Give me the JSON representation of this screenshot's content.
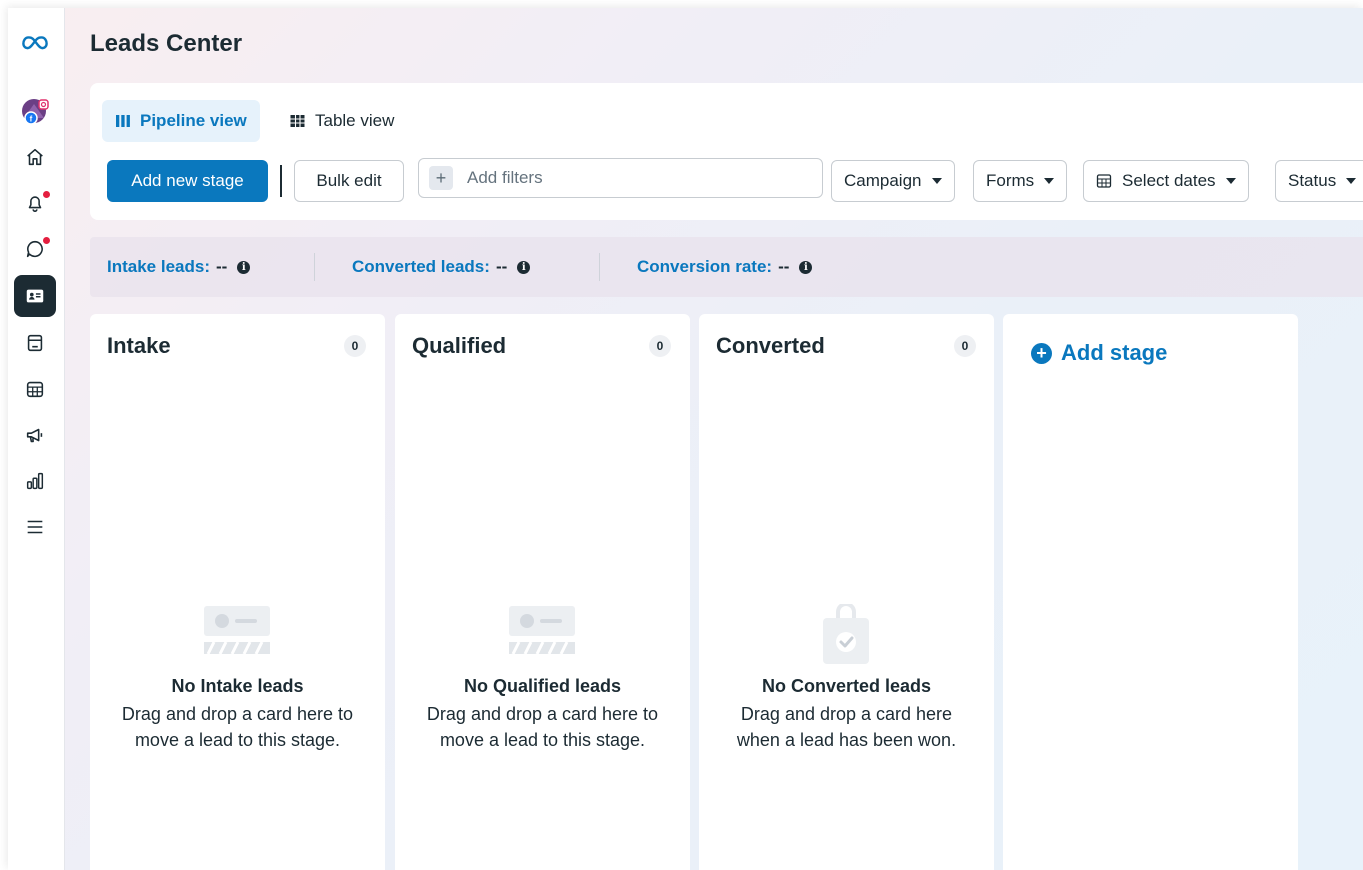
{
  "app": {
    "title": "Leads Center"
  },
  "nav": {
    "items": [
      {
        "name": "meta-logo-icon"
      },
      {
        "name": "account-avatar"
      },
      {
        "name": "home-icon"
      },
      {
        "name": "notifications-icon"
      },
      {
        "name": "messages-icon"
      },
      {
        "name": "leads-center-icon"
      },
      {
        "name": "posts-icon"
      },
      {
        "name": "calendar-icon"
      },
      {
        "name": "ads-icon"
      },
      {
        "name": "insights-icon"
      },
      {
        "name": "menu-icon"
      }
    ]
  },
  "views": {
    "pipeline": "Pipeline view",
    "table": "Table view"
  },
  "toolbar": {
    "add_stage": "Add new stage",
    "bulk_edit": "Bulk edit",
    "filter_placeholder": "Add filters",
    "filter_plus": "+",
    "campaign": "Campaign",
    "forms": "Forms",
    "dates": "Select dates",
    "status": "Status"
  },
  "metrics": {
    "intake_label": "Intake leads:",
    "intake_value": "--",
    "converted_label": "Converted leads:",
    "converted_value": "--",
    "rate_label": "Conversion rate:",
    "rate_value": "--",
    "info_glyph": "i"
  },
  "columns": [
    {
      "title": "Intake",
      "count": "0",
      "empty_title": "No Intake leads",
      "empty_desc": "Drag and drop a card here to move a lead to this stage."
    },
    {
      "title": "Qualified",
      "count": "0",
      "empty_title": "No Qualified leads",
      "empty_desc": "Drag and drop a card here to move a lead to this stage."
    },
    {
      "title": "Converted",
      "count": "0",
      "empty_title": "No Converted leads",
      "empty_desc": "Drag and drop a card here when a lead has been won."
    }
  ],
  "add_stage": {
    "label": "Add stage",
    "glyph": "+"
  },
  "colors": {
    "accent": "#0a78be",
    "text": "#1c2b33",
    "alert_dot": "#e41e3f"
  }
}
